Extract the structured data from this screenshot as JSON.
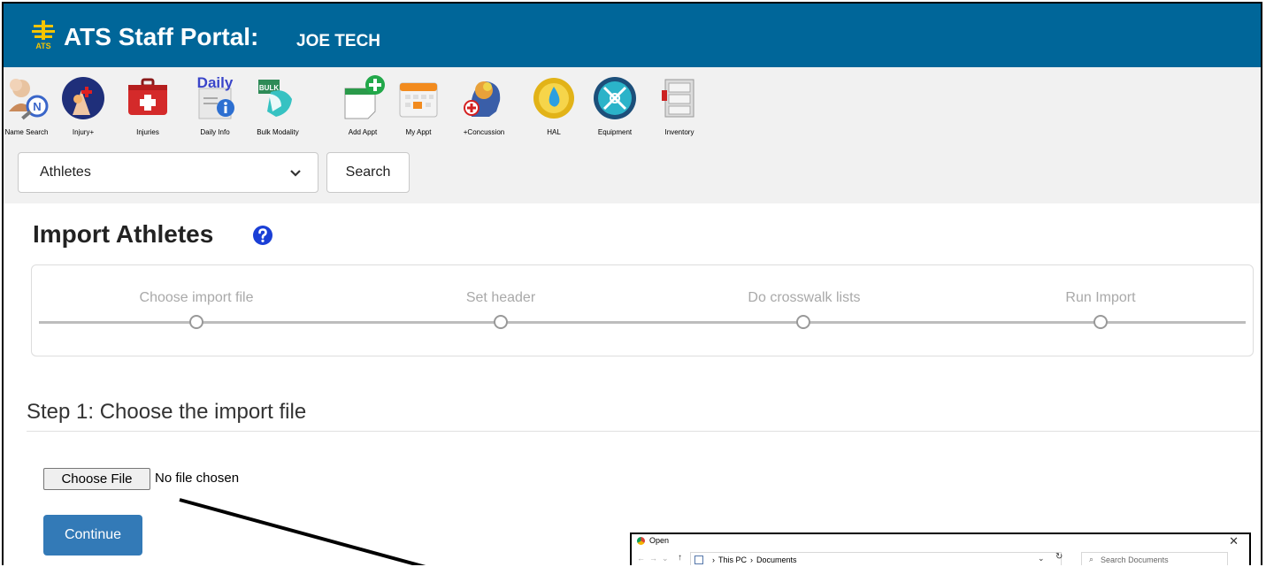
{
  "header": {
    "app_title": "ATS Staff Portal:",
    "user_name": "JOE TECH",
    "logo_text": "ATS"
  },
  "toolbar": {
    "tools": [
      {
        "label": "Name Search",
        "icon": "name-search-icon"
      },
      {
        "label": "Injury+",
        "icon": "injury-plus-icon"
      },
      {
        "label": "Injuries",
        "icon": "injuries-icon"
      },
      {
        "label": "Daily Info",
        "icon": "daily-info-icon",
        "icon_text": "Daily"
      },
      {
        "label": "Bulk Modality",
        "icon": "bulk-modality-icon",
        "icon_text": "BULK"
      },
      {
        "label": "Add Appt",
        "icon": "add-appt-icon"
      },
      {
        "label": "My Appt",
        "icon": "my-appt-icon"
      },
      {
        "label": "+Concussion",
        "icon": "concussion-icon"
      },
      {
        "label": "HAL",
        "icon": "hal-icon"
      },
      {
        "label": "Equipment",
        "icon": "equipment-icon"
      },
      {
        "label": "Inventory",
        "icon": "inventory-icon"
      }
    ],
    "select_value": "Athletes",
    "search_label": "Search"
  },
  "main": {
    "page_title": "Import Athletes",
    "steps": [
      "Choose import file",
      "Set header",
      "Do crosswalk lists",
      "Run Import"
    ],
    "step_heading": "Step 1: Choose the import file",
    "choose_file_label": "Choose File",
    "file_status": "No file chosen",
    "continue_label": "Continue"
  },
  "dialog": {
    "title": "Open",
    "path": [
      "This PC",
      "Documents"
    ],
    "search_placeholder": "Search Documents"
  },
  "colors": {
    "header_bg": "#006699",
    "toolbar_bg": "#f1f1f1",
    "primary_button": "#337ab7",
    "help_icon": "#1a3fd6"
  }
}
